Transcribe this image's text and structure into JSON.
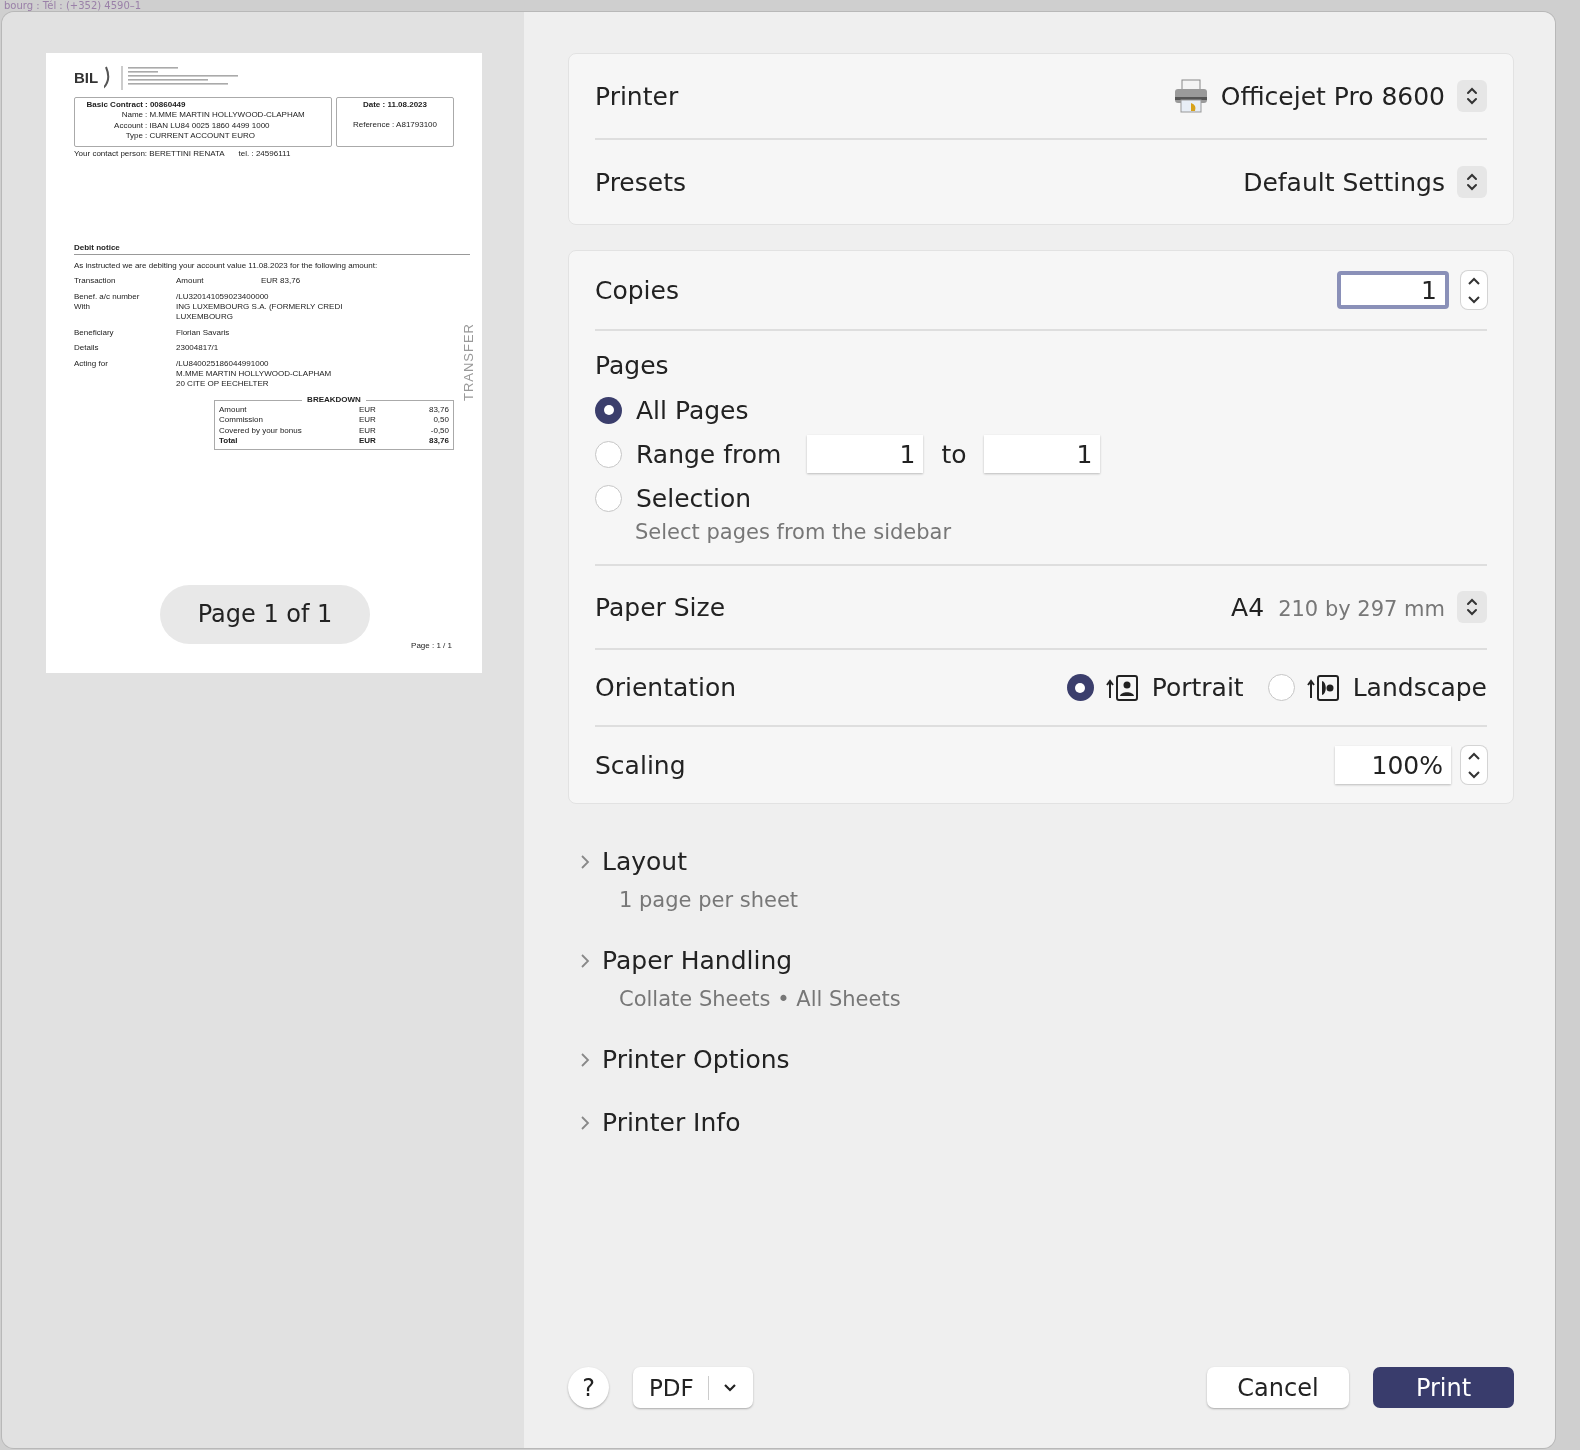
{
  "backdrop_text": "bourg : Tél : (+352) 4590–1",
  "preview": {
    "logo": "BIL",
    "contract_label": "Basic Contract",
    "contract_value": ": 00860449",
    "fields": [
      {
        "label": "Name",
        "value": ": M.MME MARTIN HOLLYWOOD-CLAPHAM"
      },
      {
        "label": "Account",
        "value": ": IBAN LU84 0025 1860 4499 1000"
      },
      {
        "label": "Type",
        "value": ": CURRENT ACCOUNT EURO"
      }
    ],
    "date": "Date : 11.08.2023",
    "reference": "Reference : A81793100",
    "contact": "Your contact person: BERETTINI RENATA",
    "tel": "tel. : 24596111",
    "notice_title": "Debit notice",
    "intro": "As instructed we are debiting your account value 11.08.2023 for the following amount:",
    "rows": [
      {
        "labels": [
          "Transaction"
        ],
        "lines": [
          "Amount"
        ],
        "amount": "EUR 83,76"
      },
      {
        "labels": [
          "Benef. a/c number",
          "With"
        ],
        "lines": [
          "/LU320141059023400000",
          "ING LUXEMBOURG S.A. (FORMERLY CREDI",
          "LUXEMBOURG"
        ]
      },
      {
        "labels": [
          "Beneficiary"
        ],
        "lines": [
          "Florian Savaris"
        ]
      },
      {
        "labels": [
          "Details"
        ],
        "lines": [
          "23004817/1"
        ]
      },
      {
        "labels": [
          "Acting for"
        ],
        "lines": [
          "/LU840025186044991000",
          "M.MME MARTIN HOLLYWOOD-CLAPHAM",
          "20 CITE OP EECHELTER"
        ]
      }
    ],
    "breakdown_title": "BREAKDOWN",
    "breakdown": [
      {
        "label": "Amount",
        "currency": "EUR",
        "amount": "83,76",
        "total": false
      },
      {
        "label": "Commission",
        "currency": "EUR",
        "amount": "0,50",
        "total": false
      },
      {
        "label": "Covered by your bonus",
        "currency": "EUR",
        "amount": "-0,50",
        "total": false
      },
      {
        "label": "Total",
        "currency": "EUR",
        "amount": "83,76",
        "total": true
      }
    ],
    "side_text": "TRANSFER",
    "page_footer": "Page : 1 / 1",
    "page_pill": "Page 1 of 1"
  },
  "printer": {
    "label": "Printer",
    "value": "Officejet Pro 8600"
  },
  "presets": {
    "label": "Presets",
    "value": "Default Settings"
  },
  "copies": {
    "label": "Copies",
    "value": "1"
  },
  "pages": {
    "label": "Pages",
    "options": [
      {
        "kind": "plain",
        "label": "All Pages",
        "selected": true
      },
      {
        "kind": "range",
        "label": "Range from",
        "selected": false
      },
      {
        "kind": "plain",
        "label": "Selection",
        "selected": false
      }
    ],
    "range_from": "1",
    "range_to_label": "to",
    "range_to": "1",
    "selection_hint": "Select pages from the sidebar"
  },
  "paper_size": {
    "label": "Paper Size",
    "value": "A4",
    "detail": "210 by 297 mm"
  },
  "orientation": {
    "label": "Orientation",
    "options": [
      {
        "kind": "portrait",
        "label": "Portrait",
        "selected": true
      },
      {
        "kind": "landscape",
        "label": "Landscape",
        "selected": false
      }
    ]
  },
  "scaling": {
    "label": "Scaling",
    "value": "100%"
  },
  "sections": [
    {
      "title": "Layout",
      "summary": "1 page per sheet"
    },
    {
      "title": "Paper Handling",
      "summary": "Collate Sheets • All Sheets"
    },
    {
      "title": "Printer Options"
    },
    {
      "title": "Printer Info"
    }
  ],
  "footer": {
    "help": "?",
    "pdf": "PDF",
    "cancel": "Cancel",
    "print": "Print"
  }
}
